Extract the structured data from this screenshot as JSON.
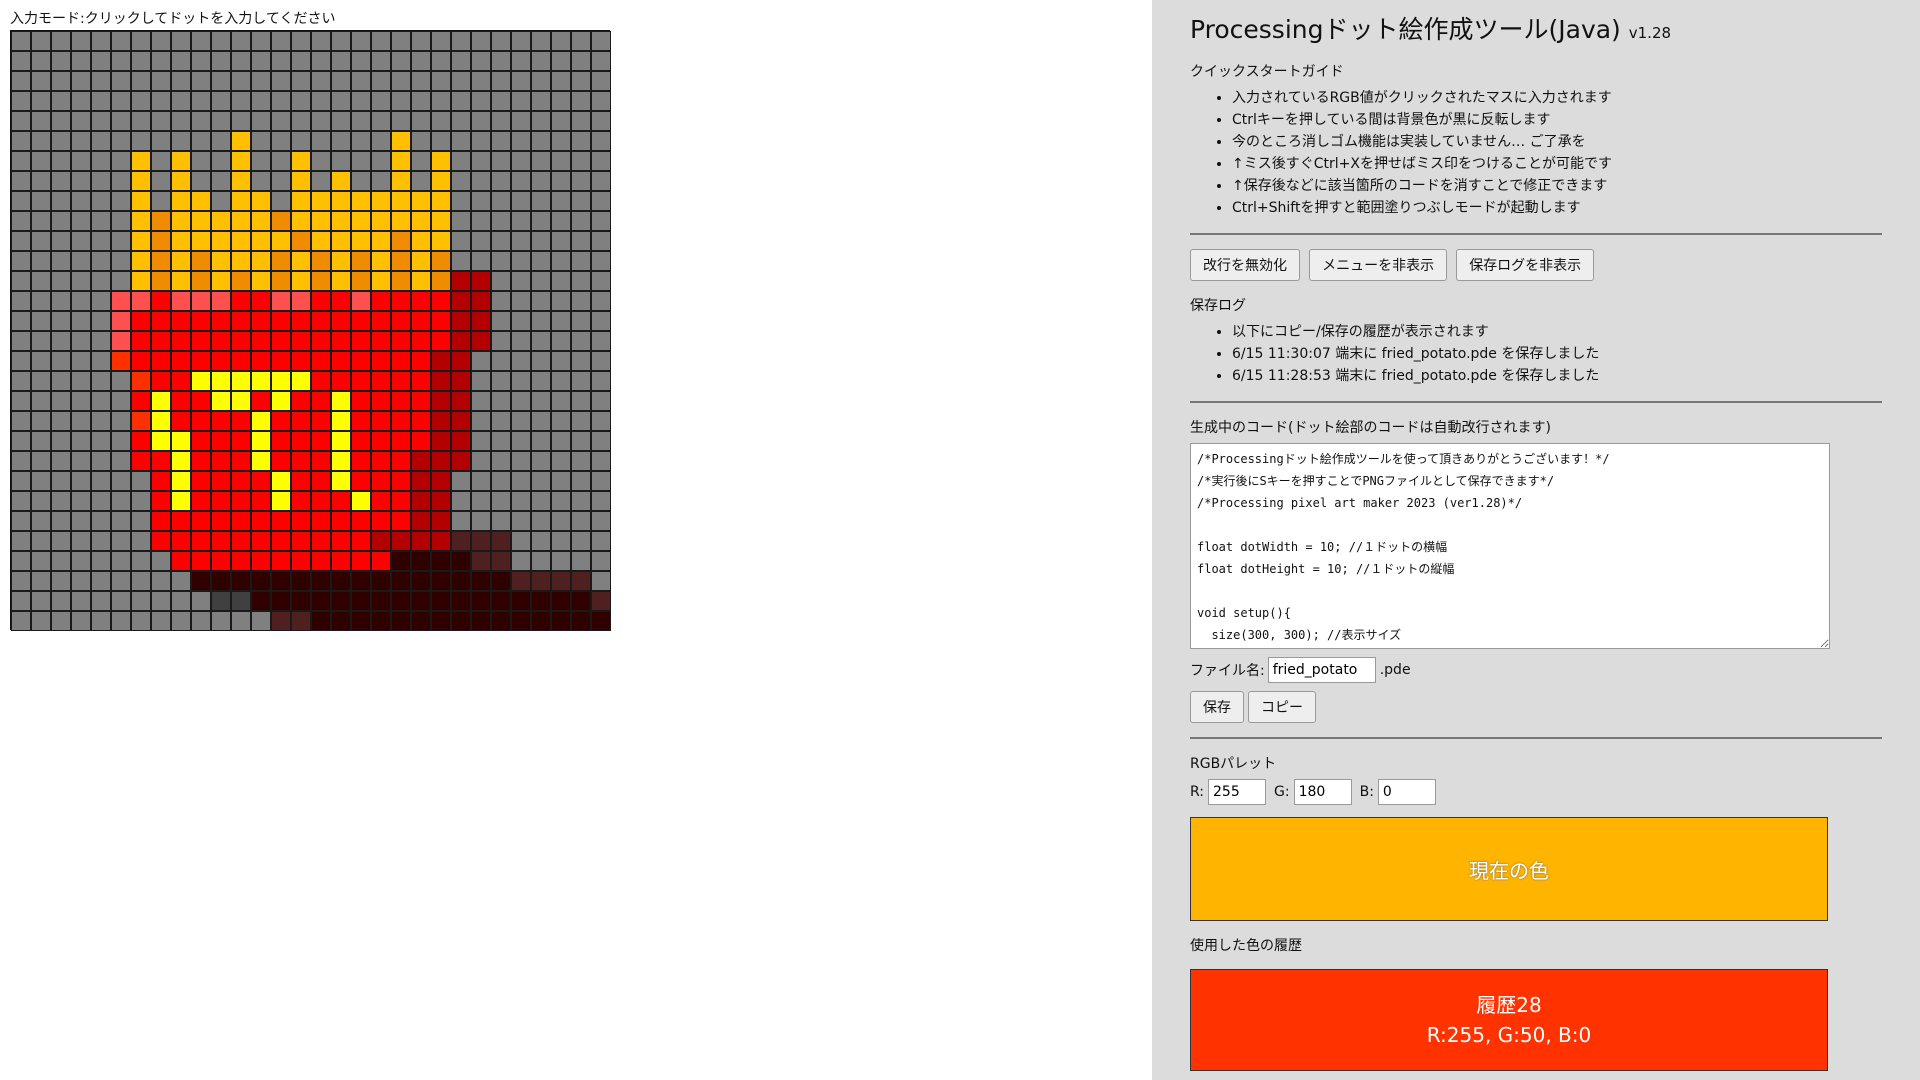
{
  "canvas": {
    "mode_label": "入力モード:クリックしてドットを入力してください",
    "palette": {
      "G": "#808080",
      "Y": "#FFC000",
      "O": "#F08C00",
      "Q": "#FFFF00",
      "R": "#FF0000",
      "P": "#FF5050",
      "D": "#B40000",
      "E": "#FF3000",
      "K": "#300000",
      "L": "#502020",
      "M": "#404040",
      "N": "#600000"
    },
    "rows": [
      "GGGGGGGGGGGGGGGGGGGGGGGGGGGGGG",
      "GGGGGGGGGGGGGGGGGGGGGGGGGGGGGG",
      "GGGGGGGGGGGGGGGGGGGGGGGGGGGGGG",
      "GGGGGGGGGGGGGGGGGGGGGGGGGGGGGG",
      "GGGGGGGGGGGGGGGGGGGGGGGGGGGGGG",
      "GGGGGGGGGGGYGGGGGGGYGGGGGGGGGG",
      "GGGGGGYGYGGYGGYGGGGYGYGGGGGGGG",
      "GGGGGGYGYGGYGGYGYGGYGYGGGGGGGG",
      "GGGGGGYGYYGYYGYYYYYYYYGGGGGGGG",
      "GGGGGGYOYYYYYOYYYYYYYYGGGGGGGG",
      "GGGGGGYOYYYYYYOYYYYOYYGGGGGGGG",
      "GGGGGGYOYOYYYOYOYOYOYOGGGGGGGG",
      "GGGGGGYOYOYOYOYOYOYOYODDGGGGGG",
      "GGGGGPPRPPPRRPPRRPRRRRDDGGGGGG",
      "GGGGGPRRRRRRRRRRRRRRRRDDGGGGGG",
      "GGGGGPRRRRRRRRRRRRRRRRDDGGGGGG",
      "GGGGGERRRRRRRRRRRRRRRDDGGGGGGG",
      "GGGGGGERRQQQQQQRRRRRRDDGGGGGGG",
      "GGGGGGRQRRQQRQRRQRRRRDDGGGGGGG",
      "GGGGGGEQRRRRQRRRQRRRRDDGGGGGGG",
      "GGGGGGRQQRRRQRRRQRRRRDDGGGGGGG",
      "GGGGGGRRQRRRQRRRQRRRDDDGGGGGGG",
      "GGGGGGGRQRRRRQRRQRRRDDGGGGGGGG",
      "GGGGGGGRQRRRRQRRRQRRDDGGGGGGGG",
      "GGGGGGGRRRRRRRRRRRRRDDGGGGGGGG",
      "GGGGGGGRRRRRRRRRRRDDDDLLLGGGGG",
      "GGGGGGGGRRRRRRRRRRRKKKKLLGGGGG",
      "GGGGGGGGGKKKKKKKKKKKKKKKKLLLLG",
      "GGGGGGGGGGMMKKKKKKKKKKKKKKKKKL",
      "GGGGGGGGGGGGGLLKKKKKKKKKKKKKKK"
    ]
  },
  "header": {
    "title": "Processingドット絵作成ツール(Java)",
    "version": "v1.28"
  },
  "guide": {
    "heading": "クイックスタートガイド",
    "items": [
      "入力されているRGB値がクリックされたマスに入力されます",
      "Ctrlキーを押している間は背景色が黒に反転します",
      "今のところ消しゴム機能は実装していません… ご了承を",
      "↑ミス後すぐCtrl+Xを押せばミス印をつけることが可能です",
      "↑保存後などに該当箇所のコードを消すことで修正できます",
      "Ctrl+Shiftを押すと範囲塗りつぶしモードが起動します"
    ]
  },
  "toolbar": {
    "disable_newline": "改行を無効化",
    "hide_menu": "メニューを非表示",
    "hide_save_log": "保存ログを非表示"
  },
  "save_log": {
    "heading": "保存ログ",
    "items": [
      "以下にコピー/保存の履歴が表示されます",
      "6/15 11:30:07 端末に fried_potato.pde を保存しました",
      "6/15 11:28:53 端末に fried_potato.pde を保存しました"
    ]
  },
  "code": {
    "heading": "生成中のコード(ドット絵部のコードは自動改行されます)",
    "text": "/*Processingドット絵作成ツールを使って頂きありがとうございます！*/\n/*実行後にSキーを押すことでPNGファイルとして保存できます*/\n/*Processing pixel art maker 2023 (ver1.28)*/\n\nfloat dotWidth = 10; //１ドットの横幅\nfloat dotHeight = 10; //１ドットの縦幅\n\nvoid setup(){\n  size(300, 300); //表示サイズ"
  },
  "file": {
    "label": "ファイル名:",
    "value": "fried_potato",
    "extension": ".pde",
    "save_label": "保存",
    "copy_label": "コピー"
  },
  "rgb": {
    "heading": "RGBパレット",
    "r_label": "R:",
    "g_label": "G:",
    "b_label": "B:",
    "r": "255",
    "g": "180",
    "b": "0",
    "current_label": "現在の色",
    "current_color": "#FFB400"
  },
  "history": {
    "heading": "使用した色の履歴",
    "items": [
      {
        "title": "履歴28",
        "rgb": "R:255, G:50, B:0",
        "color": "#FF3200"
      }
    ]
  }
}
